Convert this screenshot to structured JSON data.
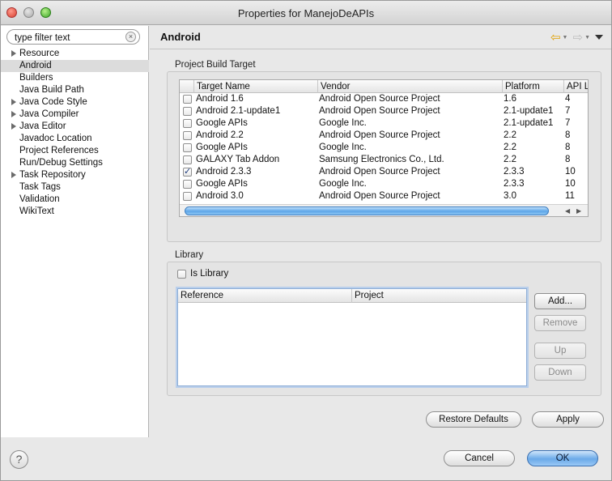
{
  "window": {
    "title": "Properties for ManejoDeAPIs"
  },
  "filter": {
    "value": "type filter text"
  },
  "tree": {
    "items": [
      {
        "label": "Resource",
        "expandable": true,
        "selected": false
      },
      {
        "label": "Android",
        "expandable": false,
        "selected": true
      },
      {
        "label": "Builders",
        "expandable": false,
        "selected": false
      },
      {
        "label": "Java Build Path",
        "expandable": false,
        "selected": false
      },
      {
        "label": "Java Code Style",
        "expandable": true,
        "selected": false
      },
      {
        "label": "Java Compiler",
        "expandable": true,
        "selected": false
      },
      {
        "label": "Java Editor",
        "expandable": true,
        "selected": false
      },
      {
        "label": "Javadoc Location",
        "expandable": false,
        "selected": false
      },
      {
        "label": "Project References",
        "expandable": false,
        "selected": false
      },
      {
        "label": "Run/Debug Settings",
        "expandable": false,
        "selected": false
      },
      {
        "label": "Task Repository",
        "expandable": true,
        "selected": false
      },
      {
        "label": "Task Tags",
        "expandable": false,
        "selected": false
      },
      {
        "label": "Validation",
        "expandable": false,
        "selected": false
      },
      {
        "label": "WikiText",
        "expandable": false,
        "selected": false
      }
    ]
  },
  "page": {
    "title": "Android",
    "build_target": {
      "group_label": "Project Build Target",
      "columns": [
        "Target Name",
        "Vendor",
        "Platform",
        "API Le"
      ],
      "rows": [
        {
          "checked": false,
          "name": "Android 1.6",
          "vendor": "Android Open Source Project",
          "platform": "1.6",
          "api": "4"
        },
        {
          "checked": false,
          "name": "Android 2.1-update1",
          "vendor": "Android Open Source Project",
          "platform": "2.1-update1",
          "api": "7"
        },
        {
          "checked": false,
          "name": "Google APIs",
          "vendor": "Google Inc.",
          "platform": "2.1-update1",
          "api": "7"
        },
        {
          "checked": false,
          "name": "Android 2.2",
          "vendor": "Android Open Source Project",
          "platform": "2.2",
          "api": "8"
        },
        {
          "checked": false,
          "name": "Google APIs",
          "vendor": "Google Inc.",
          "platform": "2.2",
          "api": "8"
        },
        {
          "checked": false,
          "name": "GALAXY Tab Addon",
          "vendor": "Samsung Electronics Co., Ltd.",
          "platform": "2.2",
          "api": "8"
        },
        {
          "checked": true,
          "name": "Android 2.3.3",
          "vendor": "Android Open Source Project",
          "platform": "2.3.3",
          "api": "10"
        },
        {
          "checked": false,
          "name": "Google APIs",
          "vendor": "Google Inc.",
          "platform": "2.3.3",
          "api": "10"
        },
        {
          "checked": false,
          "name": "Android 3.0",
          "vendor": "Android Open Source Project",
          "platform": "3.0",
          "api": "11"
        }
      ]
    },
    "library": {
      "group_label": "Library",
      "is_library_label": "Is Library",
      "is_library_checked": false,
      "columns": [
        "Reference",
        "Project"
      ],
      "buttons": {
        "add": "Add...",
        "remove": "Remove",
        "up": "Up",
        "down": "Down"
      }
    }
  },
  "buttons": {
    "restore_defaults": "Restore Defaults",
    "apply": "Apply",
    "cancel": "Cancel",
    "ok": "OK",
    "help": "?"
  },
  "colors": {
    "selection": "#dcdcdc",
    "primary_button": "#6aa9e8",
    "scroll_thumb": "#5ea6e8"
  }
}
